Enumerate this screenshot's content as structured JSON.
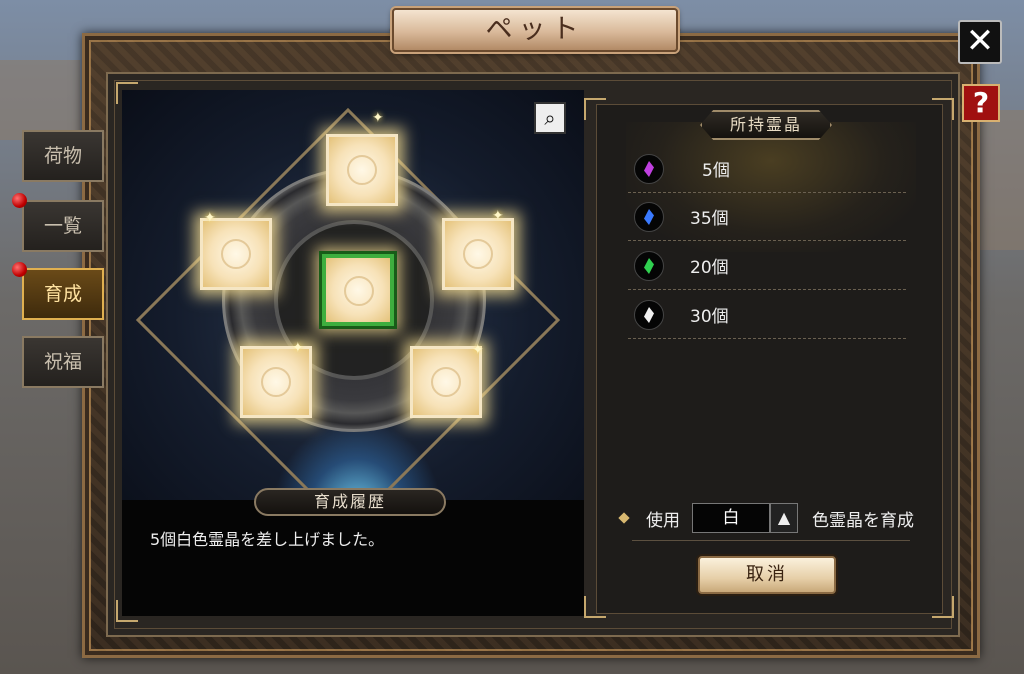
{
  "window": {
    "title": "ペット"
  },
  "controls": {
    "close_label": "✕",
    "help_label": "?"
  },
  "tabs": [
    {
      "label": "荷物",
      "active": false,
      "badge": false
    },
    {
      "label": "一覧",
      "active": false,
      "badge": true
    },
    {
      "label": "育成",
      "active": true,
      "badge": true
    },
    {
      "label": "祝福",
      "active": false,
      "badge": false
    }
  ],
  "growth": {
    "zoom_icon": "magnifier-icon",
    "slots": [
      "top",
      "left",
      "center",
      "right",
      "bottom-left",
      "bottom-right"
    ],
    "history_label": "育成履歴",
    "history_text": "5個白色霊晶を差し上げました。"
  },
  "crystals": {
    "header": "所持霊晶",
    "items": [
      {
        "color": "#c040e0",
        "count": "5個"
      },
      {
        "color": "#3a7aff",
        "count": "35個"
      },
      {
        "color": "#30d050",
        "count": "20個"
      },
      {
        "color": "#f0f0f0",
        "count": "30個"
      }
    ]
  },
  "use": {
    "prefix": "使用",
    "selected": "白",
    "arrow": "▲",
    "suffix": "色霊晶を育成"
  },
  "cancel_label": "取消",
  "colors": {
    "accent_gold": "#c6a86e",
    "tab_active": "#e0b050",
    "slot_glow": "#fff8e6"
  }
}
